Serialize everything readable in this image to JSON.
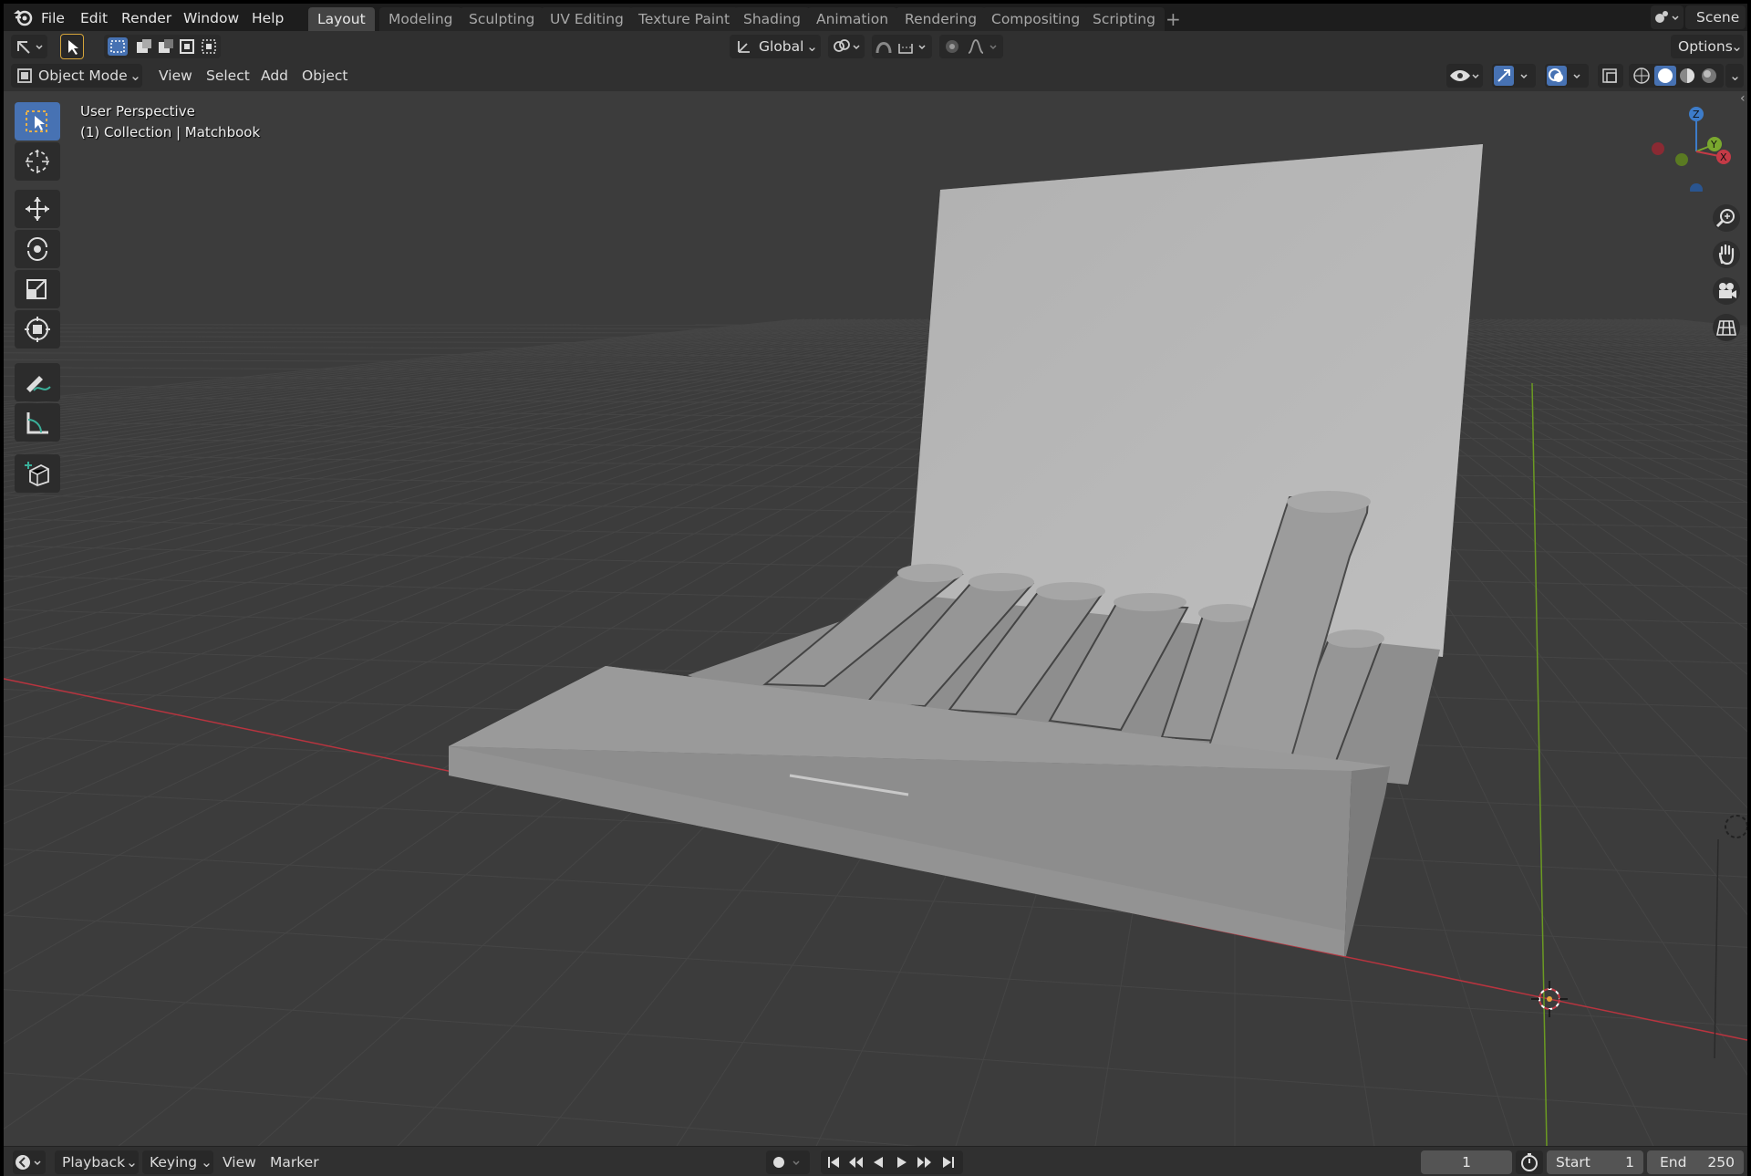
{
  "menu": {
    "file": "File",
    "edit": "Edit",
    "render": "Render",
    "window": "Window",
    "help": "Help"
  },
  "workspaces": [
    "Layout",
    "Modeling",
    "Sculpting",
    "UV Editing",
    "Texture Paint",
    "Shading",
    "Animation",
    "Rendering",
    "Compositing",
    "Scripting"
  ],
  "active_workspace": "Layout",
  "scene": {
    "label": "Scene"
  },
  "header1": {
    "transform_orientation": "Global",
    "options_label": "Options"
  },
  "header2": {
    "mode": "Object Mode",
    "view": "View",
    "select": "Select",
    "add": "Add",
    "object": "Object"
  },
  "viewport": {
    "perspective": "User Perspective",
    "collection": "(1) Collection | Matchbook",
    "gizmo_axes": {
      "z": "Z",
      "y": "Y",
      "x": "X"
    }
  },
  "colors": {
    "accent": "#4772b3",
    "x_axis": "#c43a46",
    "y_axis": "#7aa82e",
    "z_axis": "#3d7cc9",
    "viewport_bg": "#3c3c3c"
  },
  "tools": [
    "select-box",
    "cursor",
    "move",
    "rotate",
    "scale",
    "transform",
    "annotate",
    "measure",
    "add-cube"
  ],
  "timeline": {
    "playback": "Playback",
    "keying": "Keying",
    "view": "View",
    "marker": "Marker",
    "current_frame": "1",
    "start_label": "Start",
    "start_value": "1",
    "end_label": "End",
    "end_value": "250"
  }
}
